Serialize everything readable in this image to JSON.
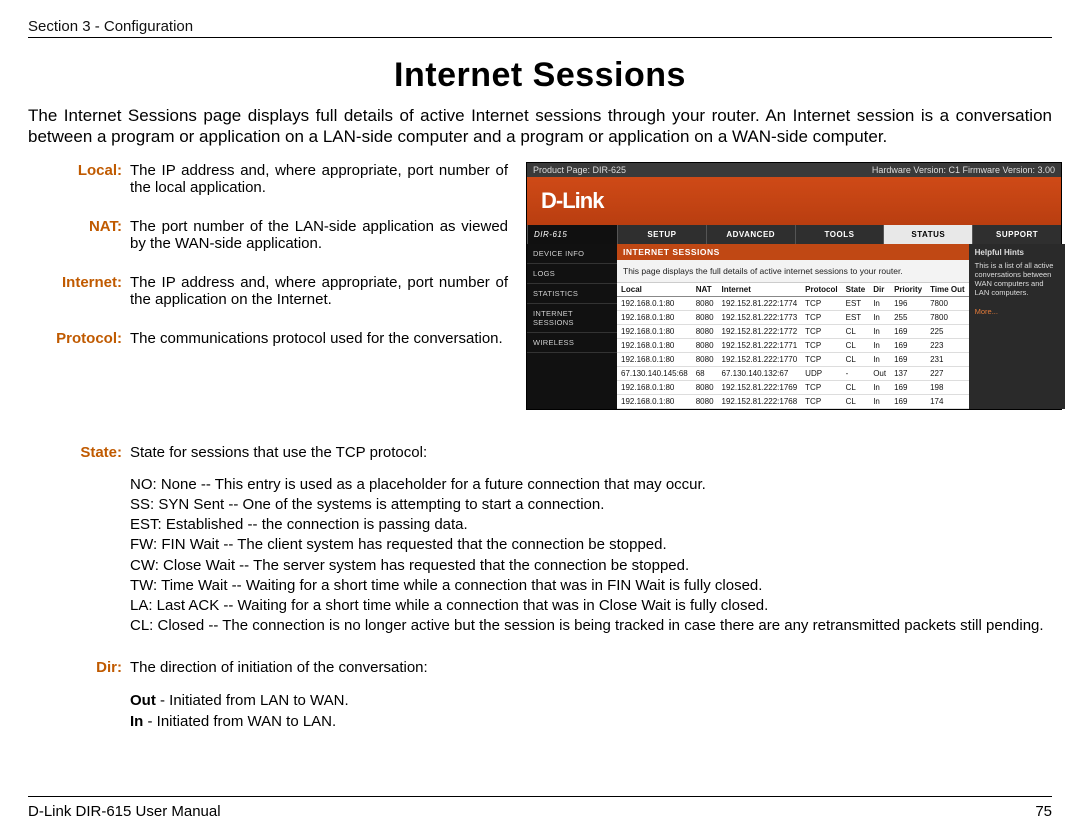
{
  "header": {
    "section": "Section 3 - Configuration"
  },
  "title": "Internet Sessions",
  "intro": "The Internet Sessions page displays full details of active Internet sessions through your router. An Internet session is a conversation between a program or application on a LAN-side computer and a program or application on a WAN-side computer.",
  "defs": {
    "local": {
      "term": "Local:",
      "body": "The IP address and, where appropriate, port number of the local application."
    },
    "nat": {
      "term": "NAT:",
      "body": "The port number of the LAN-side application as viewed by the WAN-side application."
    },
    "internet": {
      "term": "Internet:",
      "body": "The IP address and, where appropriate, port number of the application on the Internet."
    },
    "protocol": {
      "term": "Protocol:",
      "body": "The communications protocol used for the conversation."
    },
    "state": {
      "term": "State:",
      "lead": "State for sessions that use the TCP protocol:",
      "lines": [
        "NO: None -- This entry is used as a placeholder for a future connection that may occur.",
        "SS: SYN Sent -- One of the systems is attempting to start a connection.",
        "EST: Established -- the connection is passing data.",
        "FW: FIN Wait -- The client system has requested that the connection be stopped.",
        "CW: Close Wait -- The server system has requested that the connection be stopped.",
        "TW: Time Wait -- Waiting for a short time while a connection that was in FIN Wait is fully closed.",
        "LA: Last ACK -- Waiting for a short time while a connection that was in Close Wait is fully closed.",
        "CL: Closed -- The connection is no longer active but the session is being tracked in case there are any retransmitted packets still pending."
      ]
    },
    "dir": {
      "term": "Dir:",
      "lead": "The direction of initiation of the conversation:",
      "out_label": "Out",
      "out_body": " - Initiated from LAN to WAN.",
      "in_label": "In",
      "in_body": " - Initiated from WAN to LAN."
    }
  },
  "router": {
    "product": "Product Page: DIR-625",
    "hw": "Hardware Version: C1   Firmware Version: 3.00",
    "logo": "D-Link",
    "model": "DIR-615",
    "nav": [
      "SETUP",
      "ADVANCED",
      "TOOLS",
      "STATUS",
      "SUPPORT"
    ],
    "side": [
      "DEVICE INFO",
      "LOGS",
      "STATISTICS",
      "INTERNET SESSIONS",
      "WIRELESS"
    ],
    "main_title": "INTERNET SESSIONS",
    "main_desc": "This page displays the full details of active internet sessions to your router.",
    "hints_title": "Helpful Hints",
    "hints_body": "This is a list of all active conversations between WAN computers and LAN computers.",
    "hints_more": "More...",
    "columns": [
      "Local",
      "NAT",
      "Internet",
      "Protocol",
      "State",
      "Dir",
      "Priority",
      "Time Out"
    ],
    "rows": [
      [
        "192.168.0.1:80",
        "8080",
        "192.152.81.222:1774",
        "TCP",
        "EST",
        "In",
        "196",
        "7800"
      ],
      [
        "192.168.0.1:80",
        "8080",
        "192.152.81.222:1773",
        "TCP",
        "EST",
        "In",
        "255",
        "7800"
      ],
      [
        "192.168.0.1:80",
        "8080",
        "192.152.81.222:1772",
        "TCP",
        "CL",
        "In",
        "169",
        "225"
      ],
      [
        "192.168.0.1:80",
        "8080",
        "192.152.81.222:1771",
        "TCP",
        "CL",
        "In",
        "169",
        "223"
      ],
      [
        "192.168.0.1:80",
        "8080",
        "192.152.81.222:1770",
        "TCP",
        "CL",
        "In",
        "169",
        "231"
      ],
      [
        "67.130.140.145:68",
        "68",
        "67.130.140.132:67",
        "UDP",
        "-",
        "Out",
        "137",
        "227"
      ],
      [
        "192.168.0.1:80",
        "8080",
        "192.152.81.222:1769",
        "TCP",
        "CL",
        "In",
        "169",
        "198"
      ],
      [
        "192.168.0.1:80",
        "8080",
        "192.152.81.222:1768",
        "TCP",
        "CL",
        "In",
        "169",
        "174"
      ]
    ]
  },
  "footer": {
    "manual": "D-Link DIR-615 User Manual",
    "page": "75"
  }
}
